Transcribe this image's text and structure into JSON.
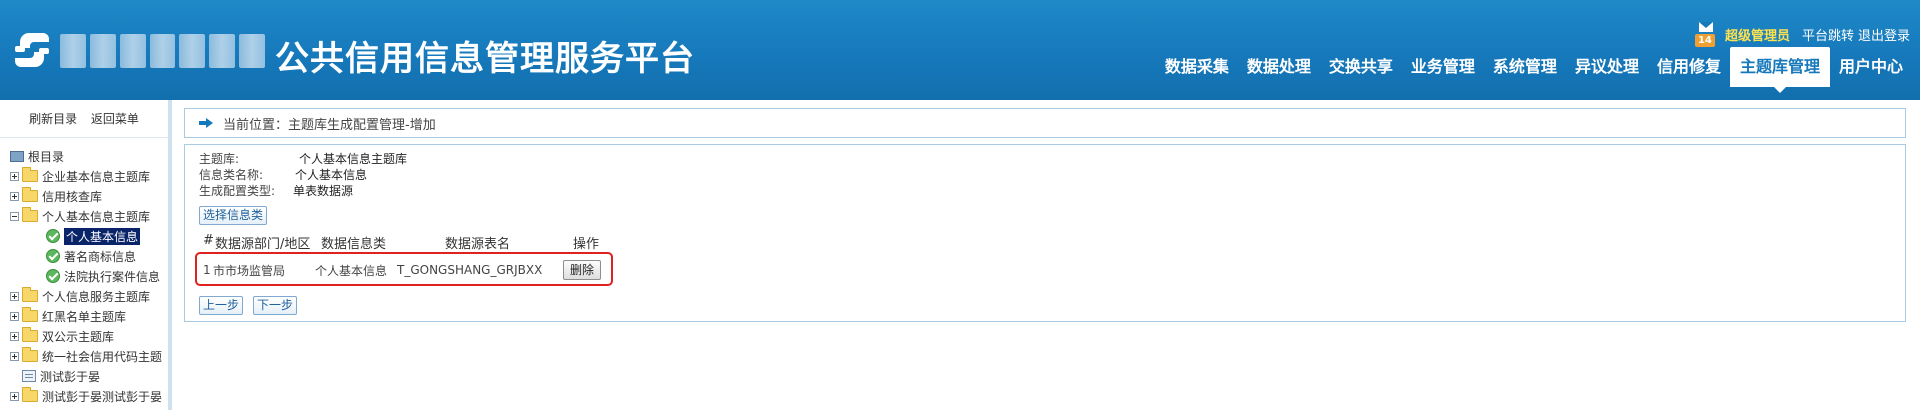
{
  "header": {
    "title_suffix": "公共信用信息管理服务平台",
    "mail_count": "14",
    "user_name": "超级管理员",
    "platform_switch": "平台跳转",
    "logout": "退出登录",
    "nav": [
      "数据采集",
      "数据处理",
      "交换共享",
      "业务管理",
      "系统管理",
      "异议处理",
      "信用修复",
      "主题库管理",
      "用户中心"
    ],
    "active_nav": "主题库管理"
  },
  "sidebar": {
    "refresh": "刷新目录",
    "back": "返回菜单",
    "tree": {
      "root": "根目录",
      "items": [
        "企业基本信息主题库",
        "信用核查库",
        "个人基本信息主题库",
        "个人基本信息",
        "著名商标信息",
        "法院执行案件信息",
        "个人信息服务主题库",
        "红黑名单主题库",
        "双公示主题库",
        "统一社会信用代码主题",
        "测试彭于晏",
        "测试彭于晏测试彭于晏"
      ]
    }
  },
  "breadcrumb": {
    "text": "当前位置：主题库生成配置管理-增加"
  },
  "form": {
    "theme_label": "主题库:",
    "theme_value": "个人基本信息主题库",
    "category_label": "信息类名称:",
    "category_value": "个人基本信息",
    "config_label": "生成配置类型:",
    "config_value": "单表数据源",
    "choose_button": "选择信息类"
  },
  "table": {
    "headers": [
      "#",
      "数据源部门/地区",
      "数据信息类",
      "数据源表名",
      "操作"
    ],
    "rows": [
      {
        "index": "1",
        "dept": "市市场监管局",
        "info_class": "个人基本信息",
        "table_name": "T_GONGSHANG_GRJBXX",
        "action": "删除"
      }
    ]
  },
  "buttons": {
    "prev": "上一步",
    "next": "下一步"
  },
  "colors": {
    "header_blue": "#1679bb",
    "admin_yellow": "#ffe14d",
    "highlight_red": "#e0221f",
    "badge_orange": "#f0a030"
  }
}
